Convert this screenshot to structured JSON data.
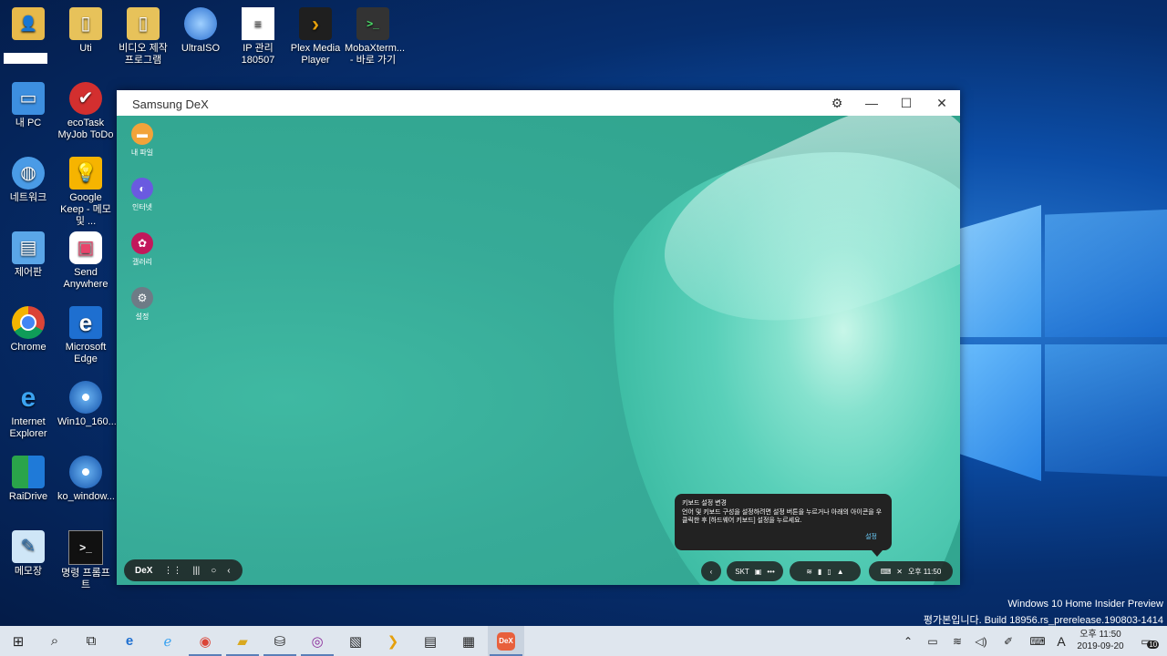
{
  "desktop": {
    "icons": [
      {
        "label": ""
      },
      {
        "label": "Uti"
      },
      {
        "label": "비디오 제작 프로그램"
      },
      {
        "label": "UltraISO"
      },
      {
        "label": "IP 관리 180507"
      },
      {
        "label": "Plex Media Player"
      },
      {
        "label": "MobaXterm... - 바로 가기"
      },
      {
        "label": "내 PC"
      },
      {
        "label": "ecoTask MyJob ToDo"
      },
      {
        "label": "네트워크"
      },
      {
        "label": "Google Keep - 메모 및 ..."
      },
      {
        "label": "제어판"
      },
      {
        "label": "Send Anywhere"
      },
      {
        "label": "Chrome"
      },
      {
        "label": "Microsoft Edge"
      },
      {
        "label": "Internet Explorer"
      },
      {
        "label": "Win10_160..."
      },
      {
        "label": "RaiDrive"
      },
      {
        "label": "ko_window..."
      },
      {
        "label": "메모장"
      },
      {
        "label": "명령 프롬프트"
      }
    ]
  },
  "dex_window": {
    "title": "Samsung DeX",
    "apps": [
      {
        "label": "내 파일"
      },
      {
        "label": "인터넷"
      },
      {
        "label": "갤러리"
      },
      {
        "label": "설정"
      }
    ],
    "dex_label": "DeX",
    "carrier": "SKT",
    "clock": "오후 11:50",
    "tooltip": {
      "title": "키보드 설정 변경",
      "body": "언어 및 키보드 구성을 설정하려면 설정 버튼을 누르거나 아래의 아이콘을 우클릭한 후 [하드웨어 키보드] 설정을 누르세요.",
      "action": "설정"
    }
  },
  "watermark": {
    "line1": "Windows 10 Home Insider Preview",
    "line2": "평가본입니다. Build 18956.rs_prerelease.190803-1414"
  },
  "taskbar": {
    "ime": "A",
    "time": "오후 11:50",
    "date": "2019-09-20",
    "notifications": "10",
    "dex_label": "DeX"
  }
}
